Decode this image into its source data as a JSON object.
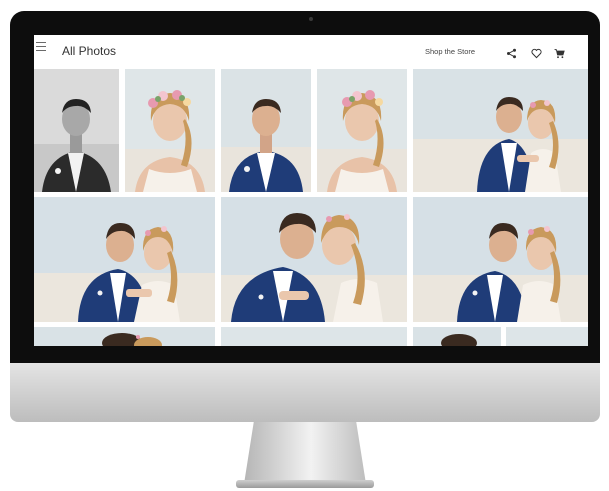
{
  "header": {
    "title": "All Photos",
    "shop_label": "Shop the Store",
    "icons": [
      "share-icon",
      "heart-icon",
      "cart-icon"
    ]
  },
  "gallery": {
    "photos": [
      {
        "subject": "groom",
        "tone": "bw"
      },
      {
        "subject": "bride",
        "tone": "color"
      },
      {
        "subject": "groom",
        "tone": "color"
      },
      {
        "subject": "bride",
        "tone": "color"
      },
      {
        "subject": "couple",
        "tone": "color"
      },
      {
        "subject": "couple",
        "tone": "color"
      },
      {
        "subject": "couple",
        "tone": "color"
      },
      {
        "subject": "couple",
        "tone": "color"
      },
      {
        "subject": "couple",
        "tone": "color"
      },
      {
        "subject": "couple",
        "tone": "color"
      },
      {
        "subject": "couple",
        "tone": "color"
      },
      {
        "subject": "couple",
        "tone": "color"
      }
    ]
  },
  "colors": {
    "screen_bg": "#ffffff",
    "bezel": "#0d0d0d",
    "sky": "#d9e2e6",
    "sand": "#ebe6dd",
    "suit": "#1f3c78",
    "hair": "#c99a5c",
    "dress": "#f6f1ea"
  }
}
